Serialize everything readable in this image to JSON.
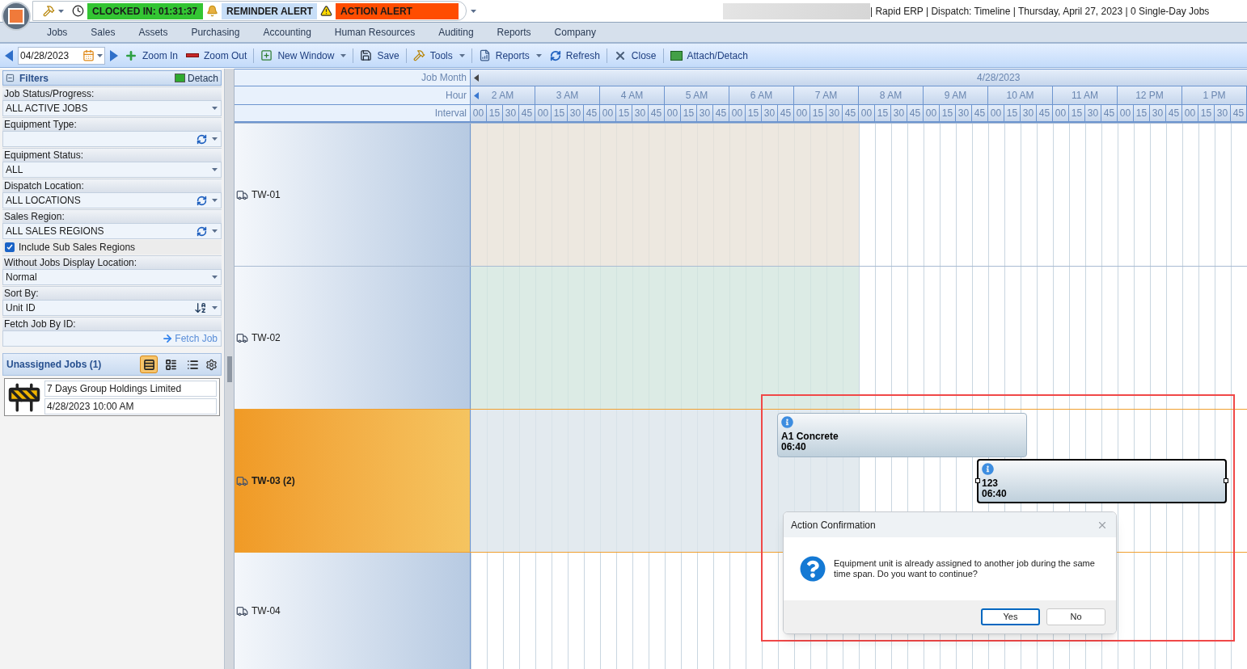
{
  "title_bar": {
    "clock_status": "CLOCKED IN: 01:31:37",
    "reminder": "REMINDER ALERT",
    "action": "ACTION ALERT",
    "title": "| Rapid ERP | Dispatch: Timeline | Thursday, April 27, 2023 | 0 Single-Day Jobs"
  },
  "menu": [
    "Jobs",
    "Sales",
    "Assets",
    "Purchasing",
    "Accounting",
    "Human Resources",
    "Auditing",
    "Reports",
    "Company"
  ],
  "toolbar": {
    "date": "04/28/2023",
    "buttons": [
      {
        "label": "Zoom In",
        "kind": "zoom-in",
        "dropdown": false
      },
      {
        "label": "Zoom Out",
        "kind": "zoom-out",
        "dropdown": false
      },
      {
        "label": "New Window",
        "kind": "new-window",
        "dropdown": true
      },
      {
        "label": "Save",
        "kind": "save",
        "dropdown": false
      },
      {
        "label": "Tools",
        "kind": "tools",
        "dropdown": true
      },
      {
        "label": "Reports",
        "kind": "reports",
        "dropdown": true
      },
      {
        "label": "Refresh",
        "kind": "refresh",
        "dropdown": false
      },
      {
        "label": "Close",
        "kind": "close",
        "dropdown": false
      },
      {
        "label": "Attach/Detach",
        "kind": "attach",
        "dropdown": false
      }
    ]
  },
  "filters": {
    "title": "Filters",
    "detach": "Detach",
    "fields": [
      {
        "kind": "select",
        "label": "Job Status/Progress:",
        "value": "ALL ACTIVE JOBS"
      },
      {
        "kind": "refresh-select",
        "label": "Equipment Type:"
      },
      {
        "kind": "select",
        "label": "Equipment Status:",
        "value": "ALL"
      },
      {
        "kind": "refresh-select",
        "label": "Dispatch Location:",
        "value": "ALL LOCATIONS"
      },
      {
        "kind": "refresh-select",
        "label": "Sales Region:",
        "value": "ALL SALES REGIONS"
      },
      {
        "kind": "checkbox",
        "label": "Include Sub Sales Regions",
        "checked": true
      },
      {
        "kind": "select",
        "label": "Without Jobs Display Location:",
        "value": "Normal"
      },
      {
        "kind": "sort-select",
        "label": "Sort By:",
        "value": "Unit ID"
      },
      {
        "kind": "fetch",
        "label": "Fetch Job By ID:",
        "button": "Fetch Job"
      }
    ]
  },
  "unassigned_jobs": {
    "title": "Unassigned Jobs (1)",
    "views": [
      {
        "selected": true
      },
      {
        "selected": false
      },
      {
        "selected": false
      }
    ],
    "jobs": [
      {
        "customer": "7 Days Group Holdings Limited",
        "date": "4/28/2023 10:00 AM"
      }
    ]
  },
  "timeline": {
    "month_label": "Job Month",
    "hour_label": "Hour",
    "interval_label": "Interval",
    "date": "4/28/2023",
    "hours": [
      {
        "label": "2 AM",
        "intervals": [
          "00",
          "15",
          "30",
          "45"
        ]
      },
      {
        "label": "3 AM",
        "intervals": [
          "00",
          "15",
          "30",
          "45"
        ]
      },
      {
        "label": "4 AM",
        "intervals": [
          "00",
          "15",
          "30",
          "45"
        ]
      },
      {
        "label": "5 AM",
        "intervals": [
          "00",
          "15",
          "30",
          "45"
        ]
      },
      {
        "label": "6 AM",
        "intervals": [
          "00",
          "15",
          "30",
          "45"
        ]
      },
      {
        "label": "7 AM",
        "intervals": [
          "00",
          "15",
          "30",
          "45"
        ]
      },
      {
        "label": "8 AM",
        "intervals": [
          "00",
          "15",
          "30",
          "45"
        ]
      },
      {
        "label": "9 AM",
        "intervals": [
          "00",
          "15",
          "30",
          "45"
        ]
      },
      {
        "label": "10 AM",
        "intervals": [
          "00",
          "15",
          "30",
          "45"
        ]
      },
      {
        "label": "11 AM",
        "intervals": [
          "00",
          "15",
          "30",
          "45"
        ]
      },
      {
        "label": "12 PM",
        "intervals": [
          "00",
          "15",
          "30",
          "45"
        ]
      },
      {
        "label": "1 PM",
        "intervals": [
          "00",
          "15",
          "30",
          "45"
        ]
      }
    ],
    "units": [
      {
        "name": "TW-01",
        "selected": false,
        "color": "#e9e2d8"
      },
      {
        "name": "TW-02",
        "selected": false,
        "color": "#d3e6de"
      },
      {
        "name": "TW-03 (2)",
        "selected": true,
        "color": "#dce5eb",
        "jobs": [
          {
            "title": "A1 Concrete",
            "time": "06:40",
            "selected": false
          },
          {
            "title": "123",
            "time": "06:40",
            "selected": true
          }
        ]
      },
      {
        "name": "TW-04",
        "selected": false
      }
    ]
  },
  "dialog": {
    "title": "Action Confirmation",
    "message": "Equipment unit is already assigned to another job during the same time span. Do you want to continue?",
    "buttons": [
      {
        "label": "Yes",
        "selected": true
      },
      {
        "label": "No",
        "selected": false
      }
    ]
  }
}
